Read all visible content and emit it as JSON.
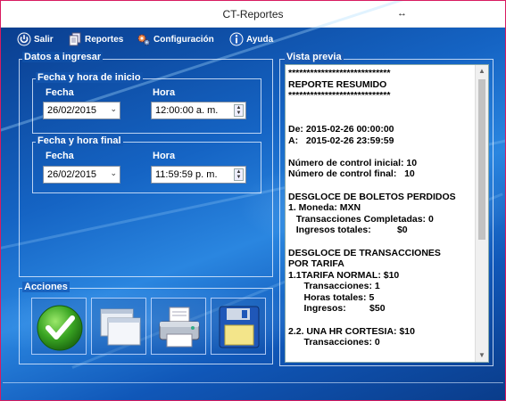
{
  "window": {
    "title": "CT-Reportes",
    "resize_glyph": "↔"
  },
  "menu": [
    {
      "label": "Salir",
      "icon": "power-icon"
    },
    {
      "label": "Reportes",
      "icon": "documents-icon"
    },
    {
      "label": "Configuración",
      "icon": "gears-icon"
    },
    {
      "label": "Ayuda",
      "icon": "info-icon"
    }
  ],
  "datos": {
    "title": "Datos a ingresar",
    "inicio": {
      "title": "Fecha y hora de inicio",
      "fecha_label": "Fecha",
      "hora_label": "Hora",
      "fecha": "26/02/2015",
      "hora": "12:00:00 a. m."
    },
    "final": {
      "title": "Fecha y hora final",
      "fecha_label": "Fecha",
      "hora_label": "Hora",
      "fecha": "26/02/2015",
      "hora": "11:59:59 p. m."
    }
  },
  "acciones": {
    "title": "Acciones",
    "buttons": [
      {
        "name": "accept-button",
        "icon": "checkmark-icon"
      },
      {
        "name": "windows-button",
        "icon": "windows-icon"
      },
      {
        "name": "print-button",
        "icon": "printer-icon"
      },
      {
        "name": "save-button",
        "icon": "floppy-disk-icon"
      }
    ]
  },
  "preview": {
    "title": "Vista previa",
    "lines": [
      "****************************",
      "REPORTE RESUMIDO",
      "****************************",
      "",
      "",
      "De: 2015-02-26 00:00:00",
      "A:   2015-02-26 23:59:59",
      "",
      "Número de control inicial: 10",
      "Número de control final:   10",
      "",
      "DESGLOCE DE BOLETOS PERDIDOS",
      "1. Moneda: MXN",
      "   Transacciones Completadas: 0",
      "   Ingresos totales:          $0",
      "",
      "DESGLOCE DE TRANSACCIONES",
      "POR TARIFA",
      "1.1TARIFA NORMAL: $10",
      "      Transacciones: 1",
      "      Horas totales: 5",
      "      Ingresos:         $50",
      "",
      "2.2. UNA HR CORTESIA: $10",
      "      Transacciones: 0"
    ]
  }
}
